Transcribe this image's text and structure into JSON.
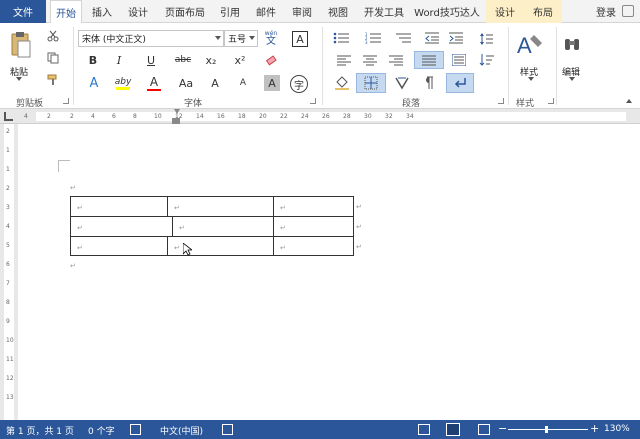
{
  "tabs": {
    "file": "文件",
    "home": "开始",
    "insert": "插入",
    "design": "设计",
    "layout": "页面布局",
    "references": "引用",
    "mailings": "邮件",
    "review": "审阅",
    "view": "视图",
    "developer": "开发工具",
    "addin": "Word技巧达人",
    "table_design": "设计",
    "table_layout": "布局",
    "login": "登录"
  },
  "clipboard": {
    "paste": "粘贴",
    "label": "剪贴板"
  },
  "font": {
    "name": "宋体 (中文正文)",
    "size": "五号",
    "phonetic_top": "wén",
    "phonetic_char": "文",
    "border_char": "A",
    "bold": "B",
    "italic": "I",
    "underline": "U",
    "strike": "abc",
    "subscript": "x₂",
    "superscript": "x²",
    "text_effect": "A",
    "highlight": "aby",
    "color": "A",
    "case": "Aa",
    "grow": "A",
    "shrink": "A",
    "shade": "A",
    "enclose": "字",
    "label": "字体"
  },
  "paragraph": {
    "label": "段落"
  },
  "styles": {
    "button": "样式",
    "label": "样式"
  },
  "editing": {
    "button": "编辑"
  },
  "ruler_numbers": [
    "4",
    "2",
    "2",
    "4",
    "6",
    "8",
    "10",
    "12",
    "14",
    "16",
    "18",
    "20",
    "22",
    "24",
    "26",
    "28",
    "30",
    "32",
    "34"
  ],
  "left_ruler_numbers": [
    "2",
    "1",
    "1",
    "2",
    "3",
    "4",
    "5",
    "6",
    "7",
    "8",
    "9",
    "10",
    "11",
    "12",
    "13"
  ],
  "status": {
    "page": "第 1 页，共 1 页",
    "words": "0 个字",
    "language": "中文(中国)",
    "zoom": "130%"
  },
  "colors": {
    "accent": "#2b579a",
    "highlight": "#ffff00",
    "font_color": "#ff0000"
  }
}
